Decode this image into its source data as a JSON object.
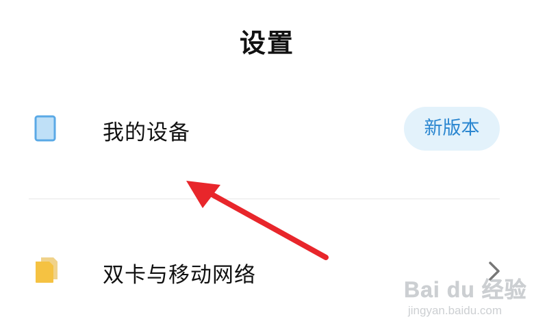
{
  "header": {
    "title": "设置"
  },
  "settings": {
    "items": [
      {
        "label": "我的设备",
        "icon": "device-icon",
        "badge": "新版本"
      },
      {
        "label": "双卡与移动网络",
        "icon": "sim-card-icon",
        "trailing_icon": "chevron-right-icon"
      }
    ]
  },
  "watermark": {
    "brand": "Bai du 经验",
    "url": "jingyan.baidu.com"
  },
  "colors": {
    "badge_background": "#e3f2fb",
    "badge_text": "#2a86d0",
    "device_icon": "#5aa9e6",
    "sim_icon": "#f5c242",
    "annotation_arrow": "#e8262b"
  }
}
